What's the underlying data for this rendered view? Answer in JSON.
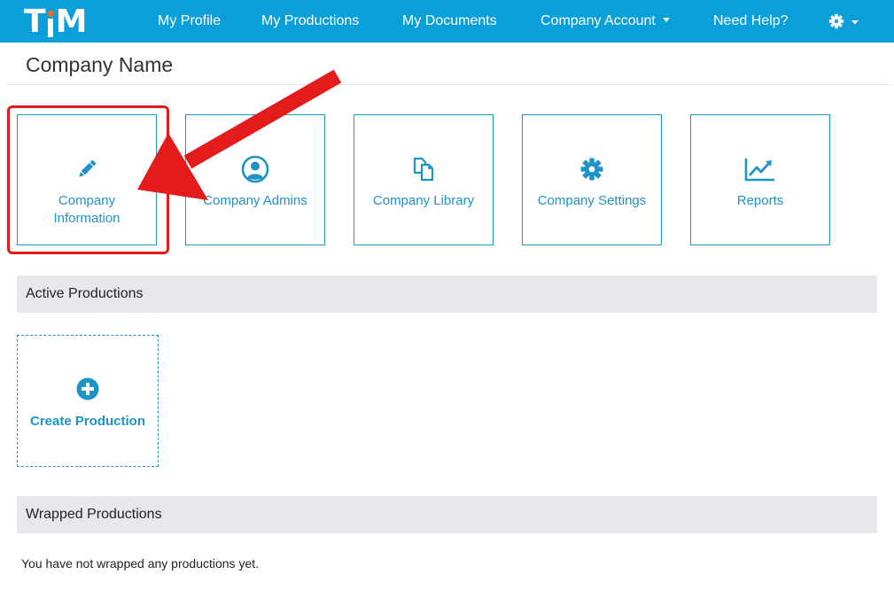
{
  "app": {
    "logo_text": "TiM"
  },
  "nav": {
    "items": [
      {
        "label": "My Profile"
      },
      {
        "label": "My Productions"
      },
      {
        "label": "My Documents"
      },
      {
        "label": "Company Account"
      },
      {
        "label": "Need Help?"
      }
    ]
  },
  "page": {
    "title": "Company Name"
  },
  "tiles": [
    {
      "label_line1": "Company",
      "label_line2": "Information",
      "icon": "pencil-icon"
    },
    {
      "label": "Company Admins",
      "icon": "user-circle-icon"
    },
    {
      "label": "Company Library",
      "icon": "copy-files-icon"
    },
    {
      "label": "Company Settings",
      "icon": "gear-icon"
    },
    {
      "label": "Reports",
      "icon": "line-chart-icon"
    }
  ],
  "sections": {
    "active": {
      "title": "Active Productions",
      "create_label": "Create Production",
      "create_icon": "plus-circle-icon"
    },
    "wrapped": {
      "title": "Wrapped Productions",
      "empty_text": "You have not wrapped any productions yet."
    }
  },
  "colors": {
    "nav_bg": "#0b9fd9",
    "accent": "#1e93c6",
    "annotation_red": "#e31b1b",
    "logo_dot": "#f06b24",
    "section_bg": "#e6e8eb"
  }
}
